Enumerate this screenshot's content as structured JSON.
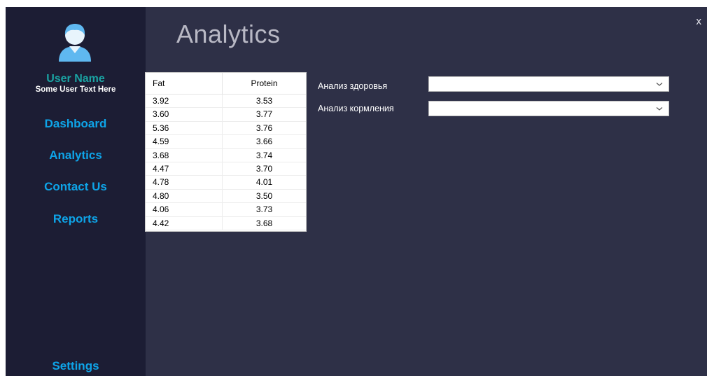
{
  "sidebar": {
    "user_name": "User Name",
    "user_text": "Some User Text Here",
    "nav": [
      "Dashboard",
      "Analytics",
      "Contact Us",
      "Reports"
    ],
    "settings_label": "Settings"
  },
  "header": {
    "title": "Analytics",
    "close_label": "x"
  },
  "table": {
    "columns": [
      "Fat",
      "Protein"
    ],
    "rows": [
      [
        "3.92",
        "3.53"
      ],
      [
        "3.60",
        "3.77"
      ],
      [
        "5.36",
        "3.76"
      ],
      [
        "4.59",
        "3.66"
      ],
      [
        "3.68",
        "3.74"
      ],
      [
        "4.47",
        "3.70"
      ],
      [
        "4.78",
        "4.01"
      ],
      [
        "4.80",
        "3.50"
      ],
      [
        "4.06",
        "3.73"
      ],
      [
        "4.42",
        "3.68"
      ]
    ]
  },
  "filters": {
    "health_label": "Анализ здоровья",
    "health_value": "",
    "feeding_label": "Анализ кормления",
    "feeding_value": ""
  },
  "colors": {
    "sidebar_bg": "#1c1d34",
    "content_bg": "#2e3047",
    "nav_text": "#0ea4e8",
    "user_name": "#1aa3a3",
    "avatar": "#5fb8f0"
  }
}
